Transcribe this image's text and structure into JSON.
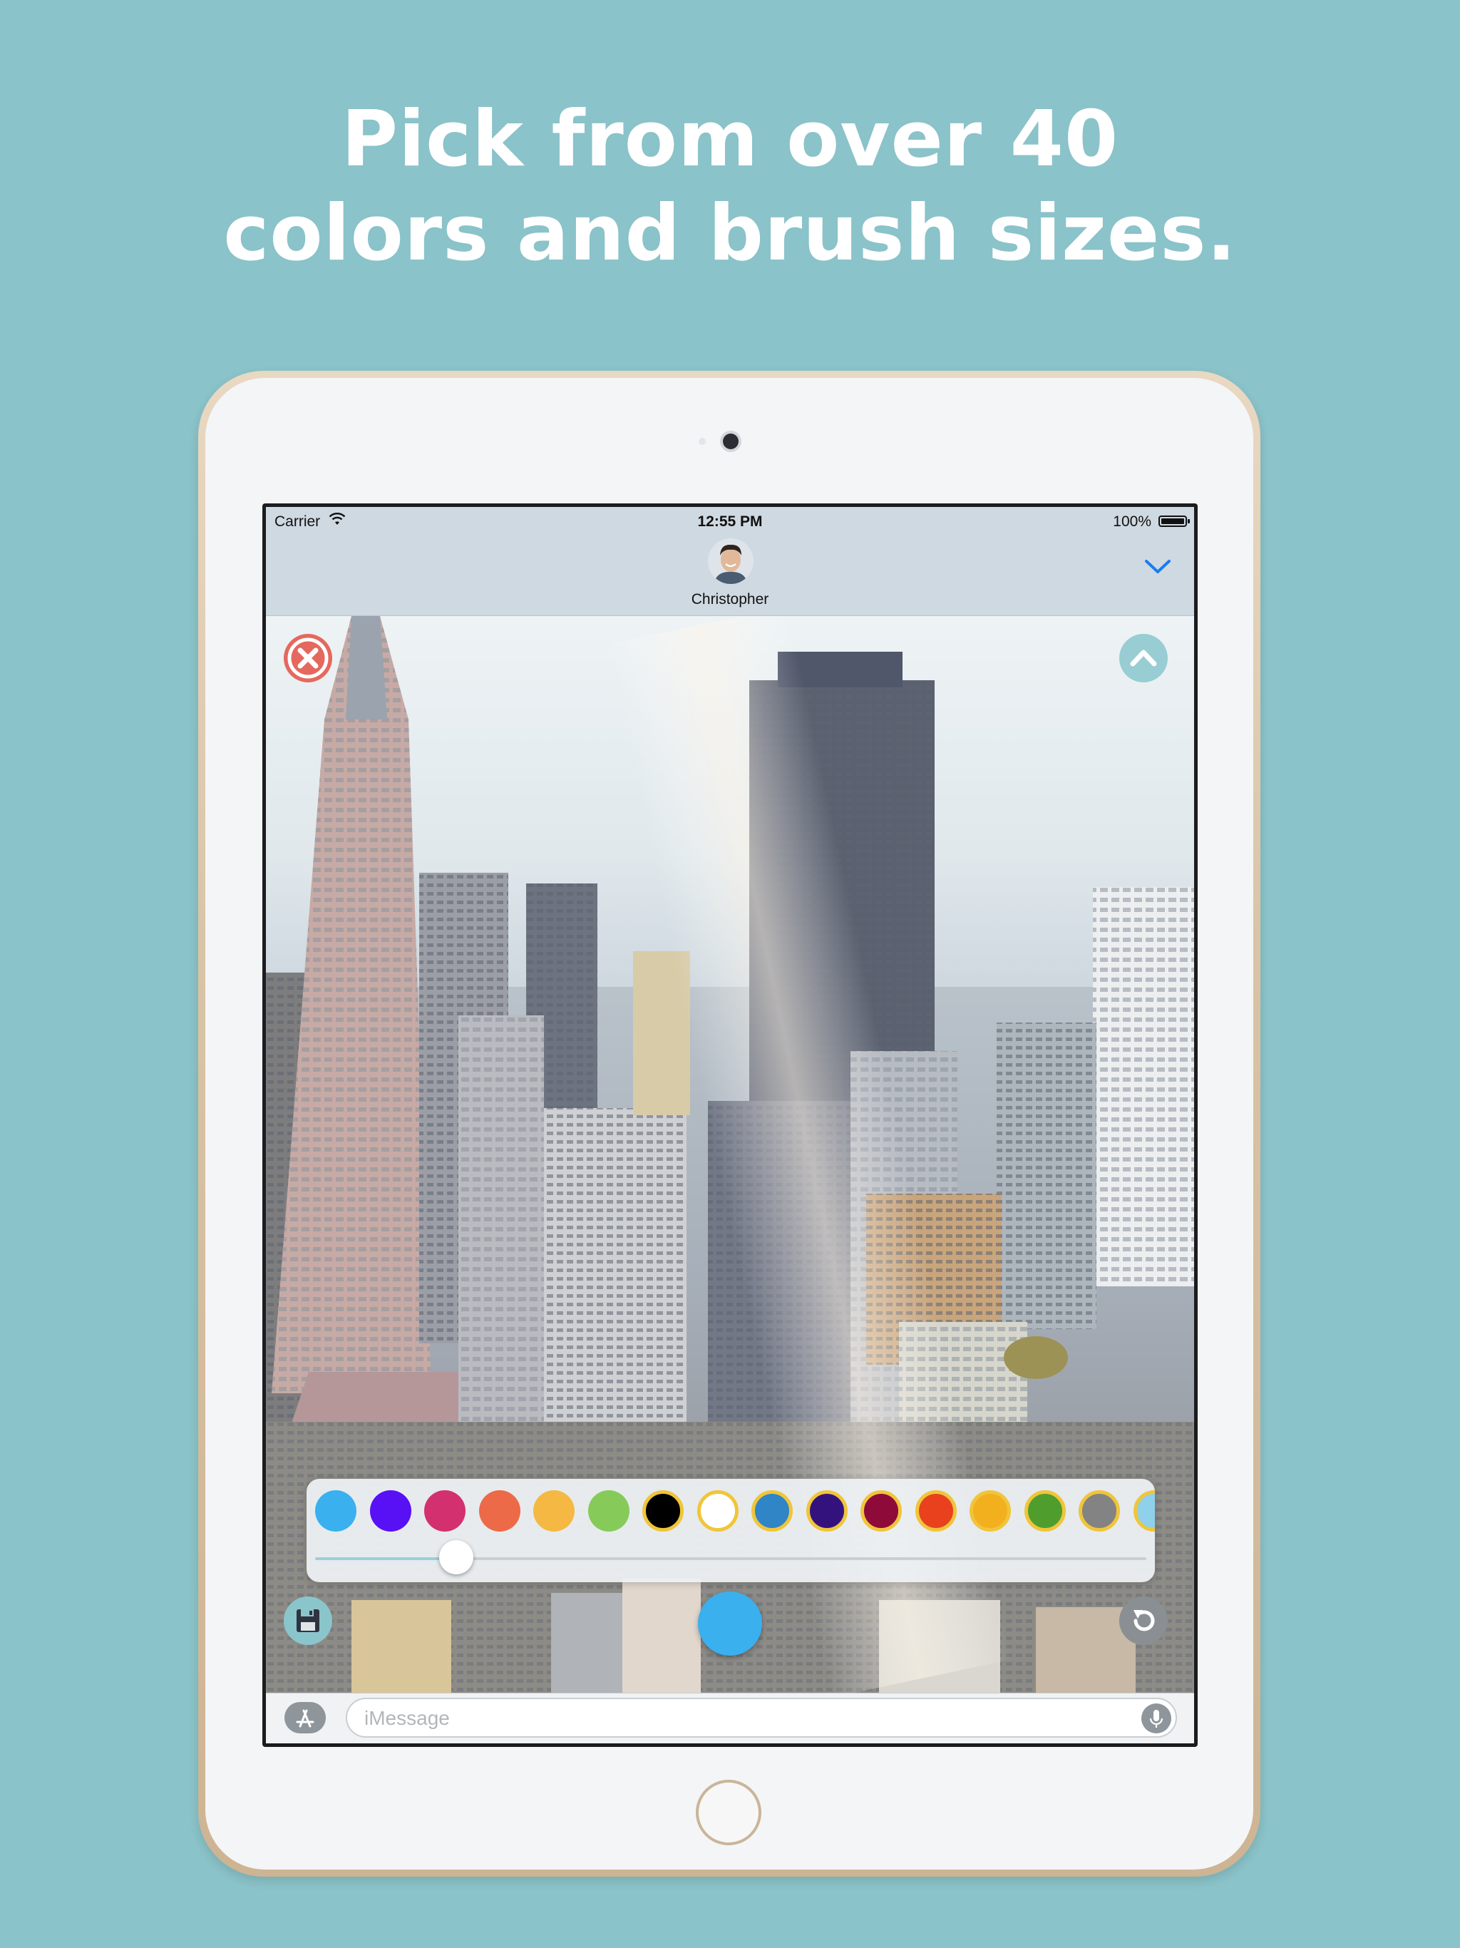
{
  "headline": {
    "line1": "Pick from over 40",
    "line2": "colors and brush sizes."
  },
  "status_bar": {
    "carrier": "Carrier",
    "time": "12:55 PM",
    "battery": "100%"
  },
  "conversation": {
    "contact_name": "Christopher"
  },
  "palette": {
    "swatches": [
      "#3ab0ef",
      "#5810f5",
      "#d2306e",
      "#ed6a48",
      "#f5b943",
      "#86cb5a",
      "#000000",
      "#ffffff",
      "#2f85c5",
      "#34127e",
      "#8e0b39",
      "#e9411d",
      "#f2b01f",
      "#4f9e2d",
      "#838383",
      "#8fd0ea"
    ],
    "brush_size_fraction": 0.17,
    "selected_color": "#3ab0ef"
  },
  "message_bar": {
    "placeholder": "iMessage"
  }
}
